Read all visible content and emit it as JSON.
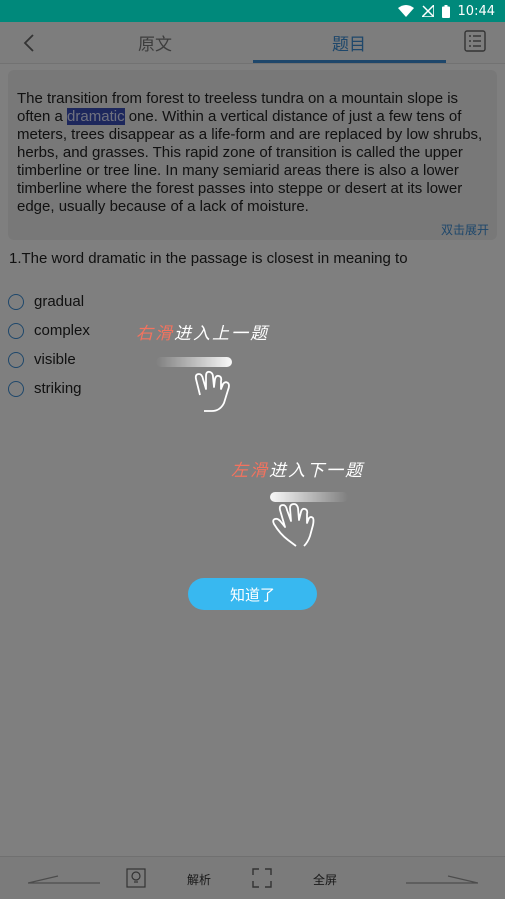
{
  "status_bar": {
    "time": "10:44"
  },
  "header": {
    "tab_original": "原文",
    "tab_questions": "题目",
    "accent_color": "#3d8fd6"
  },
  "passage": {
    "before": "The transition from forest to treeless tundra on a mountain slope is often a ",
    "highlight": "dramatic",
    "after": " one. Within a vertical distance of just a few tens of meters, trees disappear as a life-form and are replaced by low shrubs, herbs, and grasses. This rapid zone of transition is called the upper timberline or tree line. In many semiarid areas there is also a lower timberline where the forest passes into steppe or desert at its lower edge, usually because of a lack of moisture.",
    "expand_label": "双击展开"
  },
  "question": {
    "text": "1.The word dramatic in the passage is closest in meaning to",
    "options": [
      "gradual",
      "complex",
      "visible",
      "striking"
    ]
  },
  "guide": {
    "swipe_right_accent": "右滑",
    "swipe_right_rest": "进入上一题",
    "swipe_left_accent": "左滑",
    "swipe_left_rest": "进入下一题",
    "dismiss_label": "知道了"
  },
  "bottom_bar": {
    "analysis_label": "解析",
    "fullscreen_label": "全屏"
  }
}
